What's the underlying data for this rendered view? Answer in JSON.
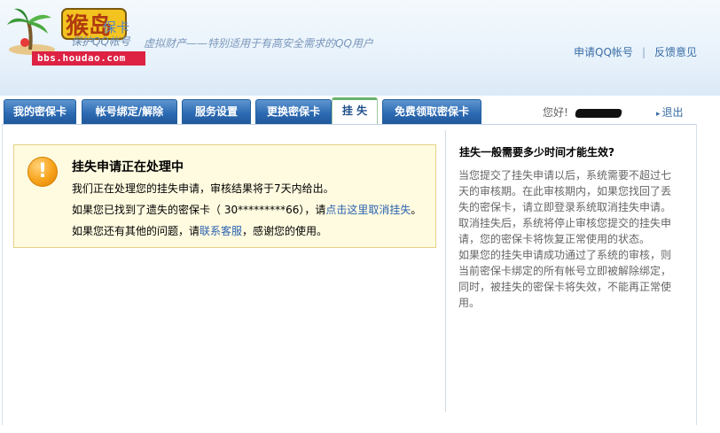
{
  "header": {
    "brand_subtitle": "保护QQ帐号",
    "tagline": "虚拟财产——特别适用于有高安全需求的QQ用户",
    "watermark_url": "bbs.houdao.com",
    "links": [
      "申请QQ帐号",
      "反馈意见"
    ]
  },
  "tabs": [
    {
      "label": "我的密保卡",
      "active": false
    },
    {
      "label": "帐号绑定/解除",
      "active": false
    },
    {
      "label": "服务设置",
      "active": false
    },
    {
      "label": "更换密保卡",
      "active": false
    },
    {
      "label": "挂 失",
      "active": true
    },
    {
      "label": "免费领取密保卡",
      "active": false
    }
  ],
  "user": {
    "greeting": "您好!",
    "logout": "退出"
  },
  "notice": {
    "title": "挂失申请正在处理中",
    "line1": "我们正在处理您的挂失申请，审核结果将于7天内给出。",
    "line2_prefix": "如果您已找到了遗失的密保卡（ 30*********66），请",
    "line2_link": "点击这里取消挂失",
    "line2_suffix": "。",
    "line3_prefix": "如果您还有其他的问题，请",
    "line3_link": "联系客服",
    "line3_suffix": "，感谢您的使用。"
  },
  "faq": {
    "title": "挂失一般需要多少时间才能生效?",
    "paragraphs": [
      "当您提交了挂失申请以后，系统需要不超过七天的审核期。在此审核期内，如果您找回了丢失的密保卡，请立即登录系统取消挂失申请。",
      "取消挂失后，系统将停止审核您提交的挂失申请，您的密保卡将恢复正常使用的状态。",
      "如果您的挂失申请成功通过了系统的审核，则当前密保卡绑定的所有帐号立即被解除绑定，同时，被挂失的密保卡将失效，不能再正常使用。"
    ]
  },
  "colors": {
    "tab_blue": "#2d6bb3",
    "active_tab_accent": "#66b36b",
    "link_blue": "#2a62b0",
    "notice_bg": "#fffbe0",
    "notice_border": "#e6cf86",
    "warning_orange": "#f7a21a"
  },
  "icons": {
    "warning": "exclamation-icon",
    "logout": "arrow-right-icon"
  }
}
